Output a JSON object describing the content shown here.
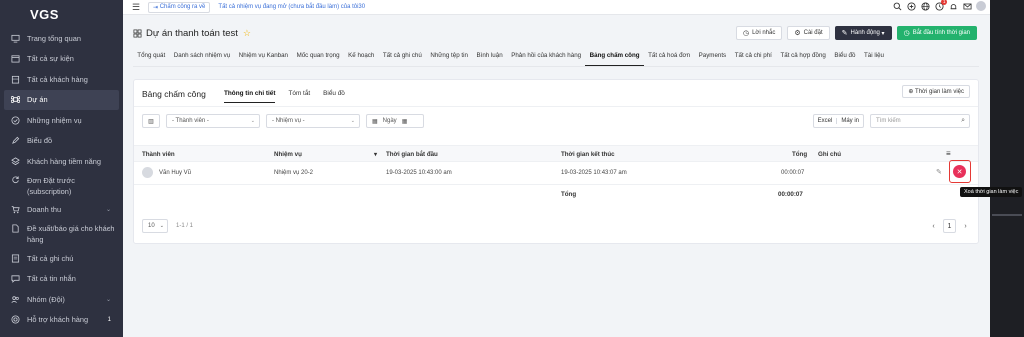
{
  "brand": {
    "logo_text": "VGS",
    "logo_accent": "#e53935"
  },
  "sidebar": {
    "items": [
      {
        "label": "Trang tổng quan",
        "icon": "monitor-icon"
      },
      {
        "label": "Tất cả sự kiện",
        "icon": "calendar-icon"
      },
      {
        "label": "Tất cả khách hàng",
        "icon": "building-icon"
      },
      {
        "label": "Dự án",
        "icon": "command-icon",
        "active": true
      },
      {
        "label": "Những nhiệm vụ",
        "icon": "check-circle-icon"
      },
      {
        "label": "Biểu đồ",
        "icon": "pen-icon"
      },
      {
        "label": "Khách hàng tiềm năng",
        "icon": "layers-icon"
      },
      {
        "label": "Đơn Đặt trước (subscription)",
        "icon": "refresh-icon"
      },
      {
        "label": "Doanh thu",
        "icon": "cart-icon",
        "chevron": true
      },
      {
        "label": "Đề xuất/báo giá cho khách hàng",
        "icon": "file-icon",
        "chevron": true
      },
      {
        "label": "Tất cả ghi chú",
        "icon": "note-icon"
      },
      {
        "label": "Tất cả tin nhắn",
        "icon": "chat-icon"
      },
      {
        "label": "Nhóm (Đội)",
        "icon": "users-icon",
        "chevron": true
      },
      {
        "label": "Hỗ trợ khách hàng",
        "icon": "support-icon",
        "badge": "1"
      }
    ]
  },
  "topbar": {
    "clock_button": "Chấm công ra về",
    "tasks_link": "Tất cả nhiệm vụ đang mở (chưa bắt đầu làm) của tôi30",
    "notif_count": "1"
  },
  "project": {
    "title": "Dự án thanh toán test",
    "reminder_button": "Lời nhắc",
    "settings_button": "Cài đặt",
    "actions_button": "Hành động",
    "start_timer_button": "Bắt đầu tính thời gian"
  },
  "tabs": [
    "Tổng quát",
    "Danh sách nhiệm vụ",
    "Nhiệm vụ Kanban",
    "Mốc quan trọng",
    "Kế hoạch",
    "Tất cả ghi chú",
    "Những tệp tin",
    "Bình luận",
    "Phản hồi của khách hàng",
    "Bảng chấm công",
    "Tất cả hoá đơn",
    "Payments",
    "Tất cả chi phí",
    "Tất cả hợp đồng",
    "Biểu đồ",
    "Tài liệu"
  ],
  "active_tab": "Bảng chấm công",
  "timesheet": {
    "title": "Bảng chấm công",
    "subtabs": [
      "Thông tin chi tiết",
      "Tóm tắt",
      "Biểu đồ"
    ],
    "add_button": "Thời gian làm việc",
    "filter_member": "- Thành viên -",
    "filter_task": "- Nhiệm vụ -",
    "filter_date": "Ngày",
    "export_excel": "Excel",
    "export_print": "Máy in",
    "search_placeholder": "Tìm kiếm",
    "columns": {
      "member": "Thành viên",
      "task": "Nhiệm vụ",
      "start": "Thời gian bắt đầu",
      "end": "Thời gian kết thúc",
      "total": "Tổng",
      "note": "Ghi chú"
    },
    "row": {
      "member": "Văn Huy Vũ",
      "task": "Nhiệm vụ 20-2",
      "start": "19-03-2025 10:43:00 am",
      "end": "19-03-2025 10:43:07 am",
      "total": "00:00:07",
      "note": ""
    },
    "footer": {
      "label": "Tổng",
      "total": "00:00:07"
    },
    "tooltip": "Xoá thời gian làm việc",
    "page_size": "10",
    "page_info": "1-1 / 1",
    "current_page": "1"
  }
}
